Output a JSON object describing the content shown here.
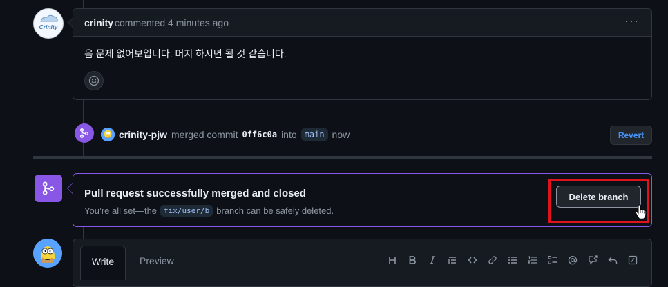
{
  "comment": {
    "author": "crinity",
    "meta": "commented 4 minutes ago",
    "menu_glyph": "···",
    "body": "음 문제 없어보입니다. 머지 하시면 될 것 같습니다.",
    "avatar_icon": "crinity-logo-icon",
    "avatar_text": "Crinity"
  },
  "merge_event": {
    "user": "crinity-pjw",
    "action": "merged commit",
    "sha": "0ff6c0a",
    "into": "into",
    "branch": "main",
    "time": "now",
    "revert_label": "Revert"
  },
  "merge_status": {
    "title": "Pull request successfully merged and closed",
    "desc_prefix": "You’re all set—the",
    "branch": "fix/user/b",
    "desc_suffix": "branch can be safely deleted.",
    "delete_label": "Delete branch"
  },
  "editor": {
    "tabs": [
      {
        "label": "Write"
      },
      {
        "label": "Preview"
      }
    ],
    "toolbar_icons": [
      "heading-icon",
      "bold-icon",
      "italic-icon",
      "quote-icon",
      "code-icon",
      "link-icon",
      "bulleted-list-icon",
      "numbered-list-icon",
      "task-list-icon",
      "mention-icon",
      "cross-reference-icon",
      "reply-icon",
      "slash-commands-icon"
    ]
  },
  "colors": {
    "background": "#0d1117",
    "merged_purple": "#8957e5",
    "link_blue": "#4493f8",
    "highlight_red": "#e0121b",
    "muted_text": "#8d96a0"
  }
}
